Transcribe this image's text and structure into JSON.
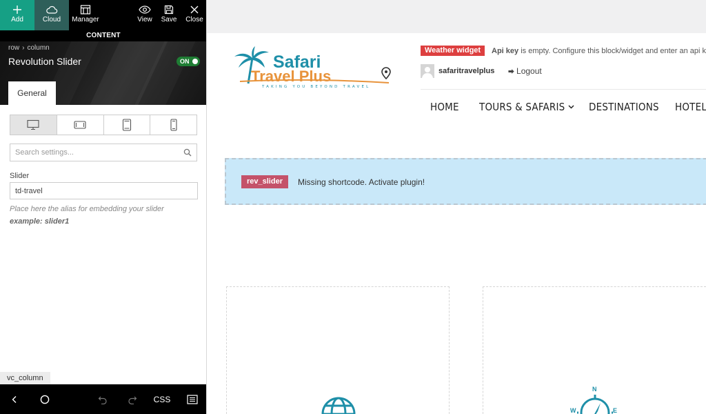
{
  "toolbar": {
    "add_label": "Add",
    "cloud_label": "Cloud",
    "manager_label": "Manager",
    "view_label": "View",
    "save_label": "Save",
    "close_label": "Close",
    "accent_add": "#16a085",
    "accent_cloud": "#2e5f5a"
  },
  "panel": {
    "section_title": "CONTENT",
    "breadcrumb": [
      "row",
      "column"
    ],
    "element_title": "Revolution Slider",
    "toggle_label": "ON",
    "tab_label": "General",
    "devices": [
      "desktop-icon",
      "tablet-landscape-icon",
      "tablet-portrait-icon",
      "mobile-icon"
    ],
    "search_placeholder": "Search settings...",
    "field_label": "Slider",
    "field_value": "td-travel",
    "hint": "Place here the alias for embedding your slider",
    "example": "example: slider1",
    "element_tag": "vc_column",
    "bottom_css_label": "CSS"
  },
  "site": {
    "logo": {
      "line1": "Safari",
      "line2": "Travel Plus",
      "tagline": "TAKING YOU BEYOND TRAVEL"
    },
    "weather_badge": "Weather widget",
    "weather_key": "Api key",
    "weather_msg": " is empty. Configure this block/widget and enter an api key",
    "username": "safaritravelplus",
    "logout_label": "Logout",
    "nav": [
      "HOME",
      "TOURS & SAFARIS",
      "DESTINATIONS",
      "HOTELS"
    ],
    "shortcode_badge": "rev_slider",
    "shortcode_msg": "Missing shortcode. Activate plugin!",
    "colors": {
      "badge_red": "#dd3f3f",
      "shortcode_bg": "#c9e8f9",
      "teal": "#1e8fa8"
    }
  }
}
